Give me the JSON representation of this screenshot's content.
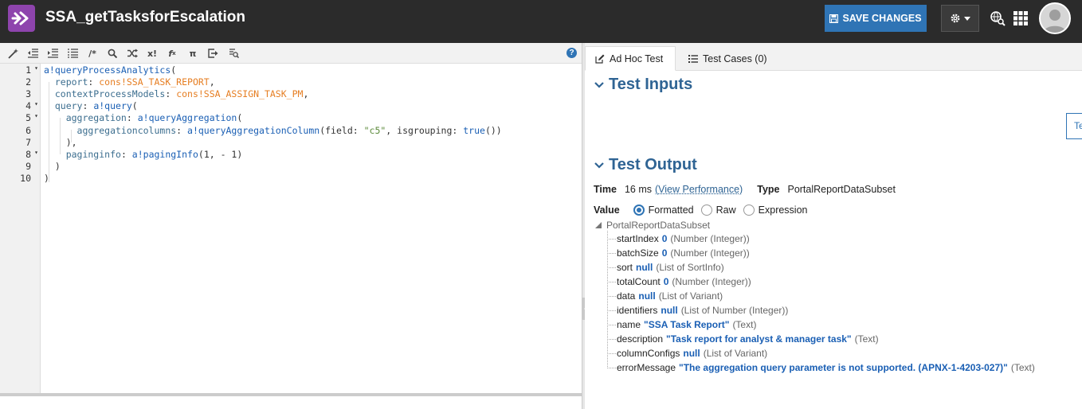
{
  "header": {
    "title": "SSA_getTasksforEscalation",
    "save_label": "SAVE CHANGES"
  },
  "editor": {
    "lines": [
      {
        "n": "1",
        "fold": true
      },
      {
        "n": "2",
        "fold": false
      },
      {
        "n": "3",
        "fold": false
      },
      {
        "n": "4",
        "fold": true
      },
      {
        "n": "5",
        "fold": true
      },
      {
        "n": "6",
        "fold": false
      },
      {
        "n": "7",
        "fold": false
      },
      {
        "n": "8",
        "fold": true
      },
      {
        "n": "9",
        "fold": false
      },
      {
        "n": "10",
        "fold": false
      }
    ],
    "code": [
      [
        {
          "t": "a!queryProcessAnalytics",
          "c": "fn"
        },
        {
          "t": "(",
          "c": "plain"
        }
      ],
      [
        {
          "t": "  report",
          "c": "key"
        },
        {
          "t": ": ",
          "c": "plain"
        },
        {
          "t": "cons!SSA_TASK_REPORT",
          "c": "const"
        },
        {
          "t": ",",
          "c": "plain"
        }
      ],
      [
        {
          "t": "  contextProcessModels",
          "c": "key"
        },
        {
          "t": ": ",
          "c": "plain"
        },
        {
          "t": "cons!SSA_ASSIGN_TASK_PM",
          "c": "const"
        },
        {
          "t": ",",
          "c": "plain"
        }
      ],
      [
        {
          "t": "  query",
          "c": "key"
        },
        {
          "t": ": ",
          "c": "plain"
        },
        {
          "t": "a!query",
          "c": "fn"
        },
        {
          "t": "(",
          "c": "plain"
        }
      ],
      [
        {
          "t": "    aggregation",
          "c": "key"
        },
        {
          "t": ": ",
          "c": "plain"
        },
        {
          "t": "a!queryAggregation",
          "c": "fn"
        },
        {
          "t": "(",
          "c": "plain"
        }
      ],
      [
        {
          "t": "      aggregationcolumns",
          "c": "key"
        },
        {
          "t": ": ",
          "c": "plain"
        },
        {
          "t": "a!queryAggregationColumn",
          "c": "fn"
        },
        {
          "t": "(field: ",
          "c": "plain"
        },
        {
          "t": "\"c5\"",
          "c": "str"
        },
        {
          "t": ", isgrouping: ",
          "c": "plain"
        },
        {
          "t": "true",
          "c": "fn"
        },
        {
          "t": "())",
          "c": "plain"
        }
      ],
      [
        {
          "t": "    ),",
          "c": "plain"
        }
      ],
      [
        {
          "t": "    paginginfo",
          "c": "key"
        },
        {
          "t": ": ",
          "c": "plain"
        },
        {
          "t": "a!pagingInfo",
          "c": "fn"
        },
        {
          "t": "(1, - 1)",
          "c": "plain"
        }
      ],
      [
        {
          "t": "  )",
          "c": "plain"
        }
      ],
      [
        {
          "t": ")",
          "c": "plain"
        }
      ]
    ]
  },
  "tabs": {
    "adhoc": "Ad Hoc Test",
    "cases": "Test Cases (0)"
  },
  "test_inputs": {
    "title": "Test Inputs",
    "clipped_button": "Te"
  },
  "test_output": {
    "title": "Test Output",
    "time_label": "Time",
    "time_value": "16 ms",
    "perf_link": "(View Performance)",
    "type_label": "Type",
    "type_value": "PortalReportDataSubset",
    "value_label": "Value",
    "radio_formatted": "Formatted",
    "radio_raw": "Raw",
    "radio_expression": "Expression",
    "root": "PortalReportDataSubset",
    "fields": [
      {
        "name": "startIndex",
        "value": "0",
        "type": "(Number (Integer))"
      },
      {
        "name": "batchSize",
        "value": "0",
        "type": "(Number (Integer))"
      },
      {
        "name": "sort",
        "value": "null",
        "type": "(List of SortInfo)"
      },
      {
        "name": "totalCount",
        "value": "0",
        "type": "(Number (Integer))"
      },
      {
        "name": "data",
        "value": "null",
        "type": "(List of Variant)"
      },
      {
        "name": "identifiers",
        "value": "null",
        "type": "(List of Number (Integer))"
      },
      {
        "name": "name",
        "value": "\"SSA Task Report\"",
        "type": "(Text)"
      },
      {
        "name": "description",
        "value": "\"Task report for analyst & manager task\"",
        "type": "(Text)"
      },
      {
        "name": "columnConfigs",
        "value": "null",
        "type": "(List of Variant)"
      },
      {
        "name": "errorMessage",
        "value": "\"The aggregation query parameter is not supported. (APNX-1-4203-027)\"",
        "type": "(Text)"
      }
    ]
  },
  "colors": {
    "header_bg": "#2b2b2b",
    "logo": "#8e44ad",
    "primary": "#2f74b5",
    "section_title": "#2f6494"
  }
}
